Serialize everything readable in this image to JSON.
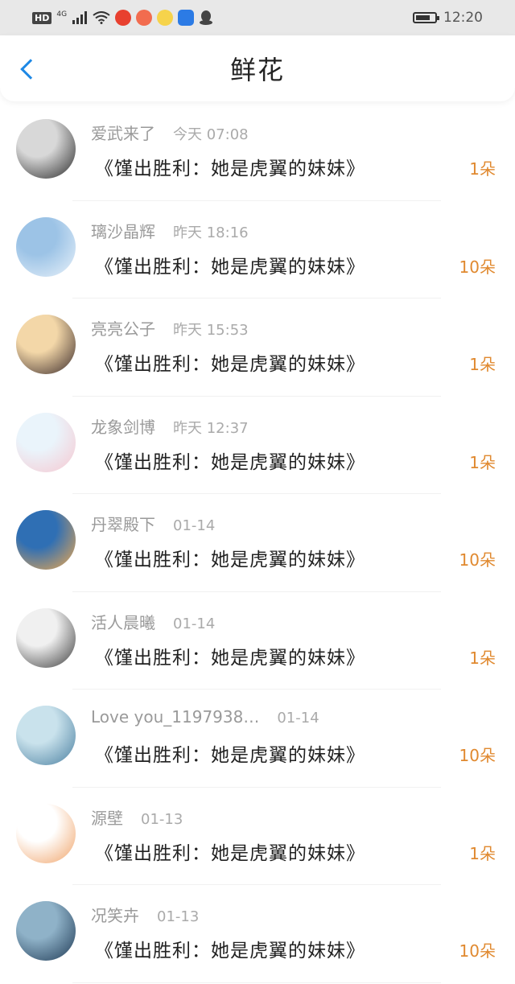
{
  "status_bar": {
    "hd": "HD",
    "network": "4G",
    "time": "12:20",
    "battery_level": 0.75,
    "app_icons": [
      "weibo-icon",
      "podcast-icon",
      "face-icon",
      "lightbulb-icon",
      "qq-icon"
    ]
  },
  "header": {
    "title": "鲜花",
    "back_icon": "chevron-left-icon"
  },
  "colors": {
    "accent": "#1e88e5",
    "count": "#e0892f",
    "meta": "#9a9a9a"
  },
  "items": [
    {
      "user": "爱武来了",
      "time": "今天 07:08",
      "book": "《馑出胜利：她是虎翼的妹妹》",
      "count": "1朵",
      "avatar": [
        "#d8d8d8",
        "#2a2a2a"
      ]
    },
    {
      "user": "璃沙晶辉",
      "time": "昨天 18:16",
      "book": "《馑出胜利：她是虎翼的妹妹》",
      "count": "10朵",
      "avatar": [
        "#9cc3e6",
        "#e9f2fa"
      ]
    },
    {
      "user": "亮亮公子",
      "time": "昨天 15:53",
      "book": "《馑出胜利：她是虎翼的妹妹》",
      "count": "1朵",
      "avatar": [
        "#f3d7a8",
        "#3a2a2a"
      ]
    },
    {
      "user": "龙象剑博",
      "time": "昨天 12:37",
      "book": "《馑出胜利：她是虎翼的妹妹》",
      "count": "1朵",
      "avatar": [
        "#eaf4fb",
        "#f6c7d0"
      ]
    },
    {
      "user": "丹翠殿下",
      "time": "01-14",
      "book": "《馑出胜利：她是虎翼的妹妹》",
      "count": "10朵",
      "avatar": [
        "#2f6fb4",
        "#f2a94c"
      ]
    },
    {
      "user": "活人晨曦",
      "time": "01-14",
      "book": "《馑出胜利：她是虎翼的妹妹》",
      "count": "1朵",
      "avatar": [
        "#f0f0f0",
        "#3c3c3c"
      ]
    },
    {
      "user": "Love you_1197938…",
      "time": "01-14",
      "book": "《馑出胜利：她是虎翼的妹妹》",
      "count": "10朵",
      "avatar": [
        "#c9e2ec",
        "#4a7fa0"
      ]
    },
    {
      "user": "源壁",
      "time": "01-13",
      "book": "《馑出胜利：她是虎翼的妹妹》",
      "count": "1朵",
      "avatar": [
        "#ffffff",
        "#f0a46a"
      ]
    },
    {
      "user": "况笑卉",
      "time": "01-13",
      "book": "《馑出胜利：她是虎翼的妹妹》",
      "count": "10朵",
      "avatar": [
        "#8fb2c8",
        "#1f3a55"
      ]
    }
  ]
}
